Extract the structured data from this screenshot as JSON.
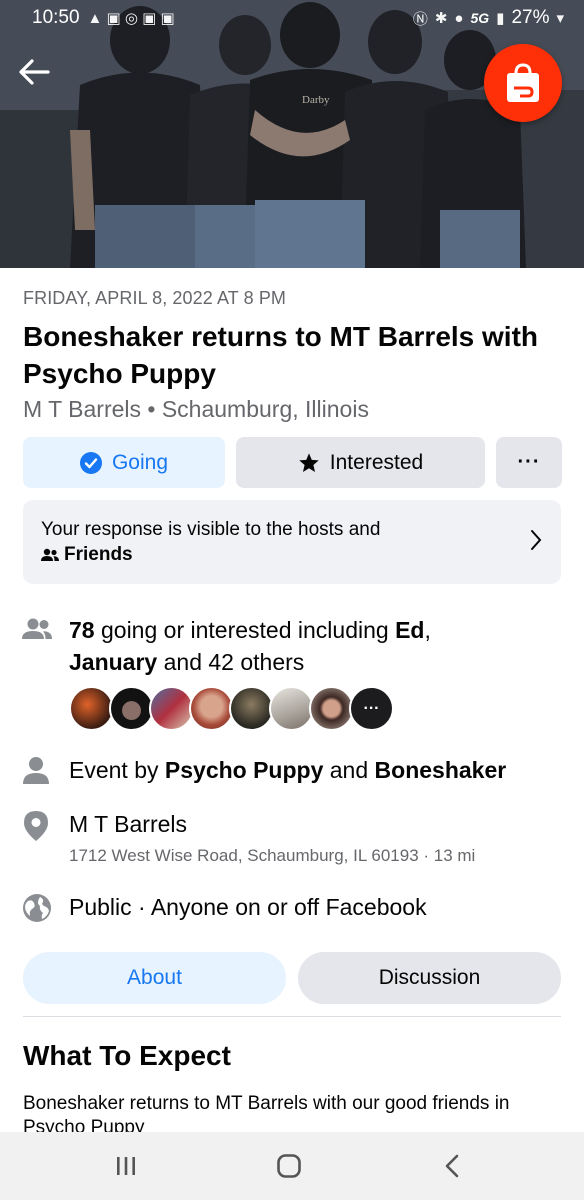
{
  "status_bar": {
    "time": "10:50",
    "battery": "27%",
    "network": "5G"
  },
  "cover": {
    "band_shirt_text": "Darby"
  },
  "event": {
    "date": "FRIDAY, APRIL 8, 2022 AT 8 PM",
    "title": "Boneshaker returns to MT Barrels with Psycho Puppy",
    "venue_line": "M T Barrels • Schaumburg, Illinois"
  },
  "actions": {
    "going_label": "Going",
    "interested_label": "Interested",
    "more_label": "···"
  },
  "notice": {
    "text": "Your response is visible to the hosts and",
    "audience": "Friends"
  },
  "attendance": {
    "count": "78",
    "text_a": " going or interested including ",
    "name1": "Ed",
    "text_b": ",",
    "name2": "January",
    "text_c": " and 42 others",
    "more_avatars": "···"
  },
  "hosts": {
    "prefix": "Event by ",
    "host1": "Psycho Puppy",
    "joiner": " and ",
    "host2": "Boneshaker"
  },
  "location": {
    "name": "M T Barrels",
    "address": "1712 West Wise Road, Schaumburg, IL 60193 · 13 mi"
  },
  "privacy": {
    "text": "Public · Anyone on or off Facebook"
  },
  "tabs": {
    "about": "About",
    "discussion": "Discussion"
  },
  "about": {
    "heading": "What To Expect",
    "description": "Boneshaker returns to MT Barrels with our good friends in Psycho Puppy"
  },
  "icons": {
    "back": "back-arrow-icon",
    "shop": "shopping-bag-icon",
    "going": "check-circle-icon",
    "interested": "star-icon",
    "people": "people-icon",
    "person": "person-icon",
    "pin": "location-pin-icon",
    "globe": "globe-icon",
    "chevron": "chevron-right-icon"
  },
  "colors": {
    "accent": "#1877f2",
    "accent_bg": "#e7f3ff",
    "button_gray": "#e4e6eb",
    "secondary_text": "#65676b",
    "shop_red": "#ff3008"
  }
}
